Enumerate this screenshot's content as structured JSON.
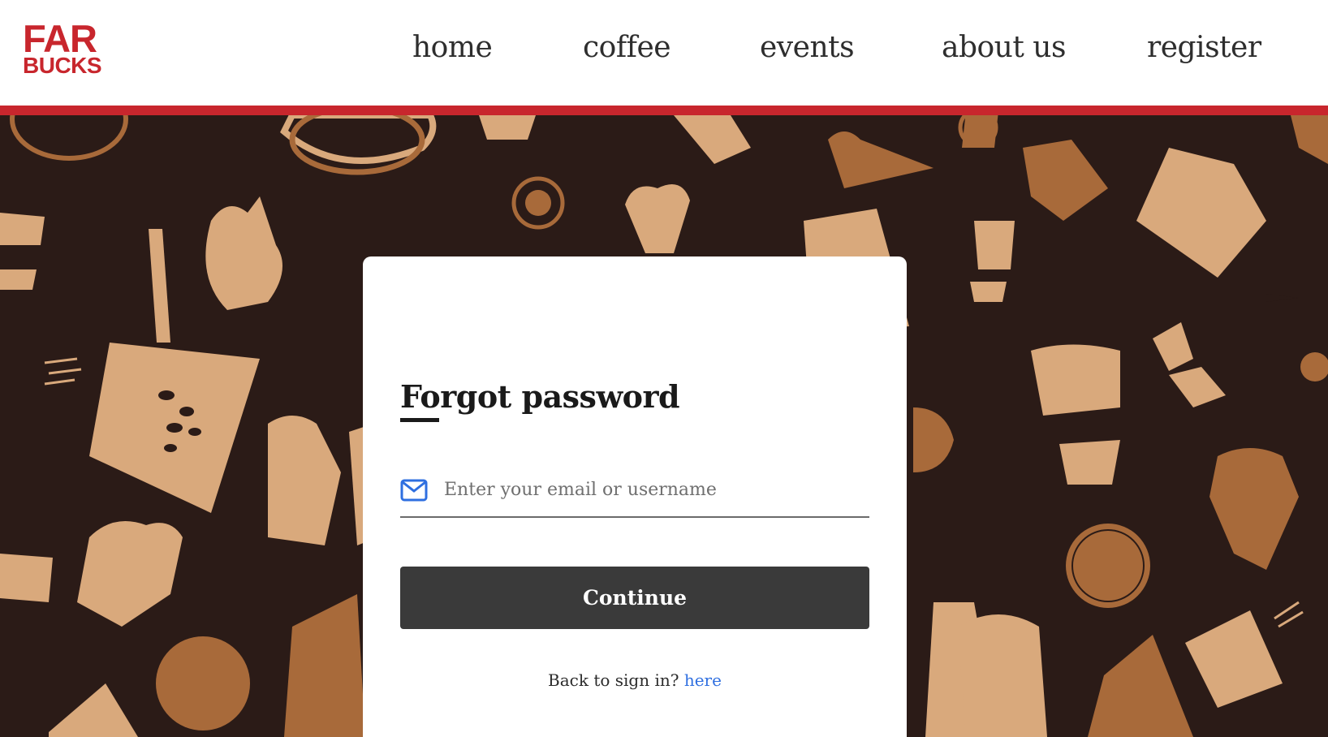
{
  "header": {
    "logo_line1": "FAR",
    "logo_line2": "BUCKS",
    "nav": {
      "home": "home",
      "coffee": "coffee",
      "events": "events",
      "about": "about us",
      "register": "register"
    }
  },
  "form": {
    "title": "Forgot password",
    "email_placeholder": "Enter your email or username",
    "email_value": "",
    "continue_label": "Continue",
    "back_text": "Back to sign in?",
    "back_link": "here"
  },
  "icons": {
    "email": "envelope-icon"
  },
  "colors": {
    "brand_red": "#c8262d",
    "background_dark": "#2b1b17",
    "tan": "#d9a97c",
    "brown": "#a86a3a",
    "button": "#3a3a3a",
    "link": "#2f6fe0",
    "icon_blue": "#2f6fe0"
  }
}
